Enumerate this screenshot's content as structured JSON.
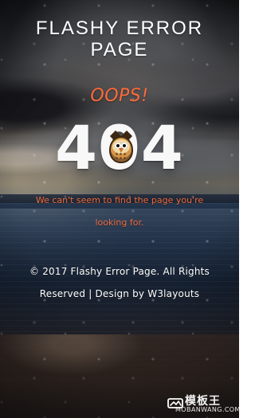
{
  "header": {
    "title_line_1": "FLASHY ERROR",
    "title_line_2": "PAGE"
  },
  "error": {
    "oops": "OOPS!",
    "code": "404",
    "message": "We can't seem to find the page you're looking for."
  },
  "footer": {
    "line_1": "© 2017 Flashy Error Page. All Rights",
    "line_2": "Reserved | Design by W3layouts"
  },
  "watermark": {
    "main": "模板王",
    "sub": "MOBANWANG.COM"
  },
  "icons": {
    "owl": "owl-icon",
    "watermark_logo": "watermark-logo-icon"
  },
  "colors": {
    "accent_orange": "#ff6a39",
    "message_orange": "#f16b3f",
    "text_white": "#ffffff"
  }
}
